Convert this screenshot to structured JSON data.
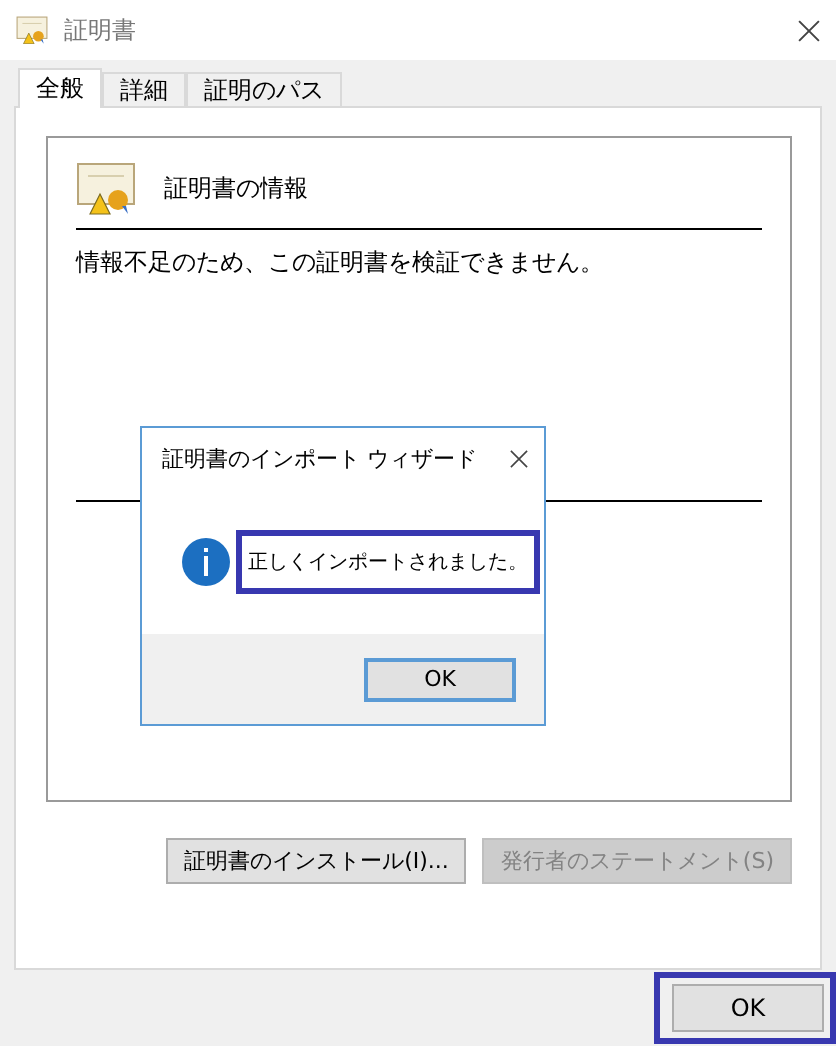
{
  "window": {
    "title": "証明書"
  },
  "tabs": [
    {
      "label": "全般",
      "selected": true
    },
    {
      "label": "詳細",
      "selected": false
    },
    {
      "label": "証明のパス",
      "selected": false
    }
  ],
  "certificate": {
    "heading": "証明書の情報",
    "message": "情報不足のため、この証明書を検証できません。"
  },
  "buttons": [
    {
      "label": "証明書のインストール(I)...",
      "disabled": false
    },
    {
      "label": "発行者のステートメント(S)",
      "disabled": true
    }
  ],
  "ok_button": {
    "label": "OK",
    "highlighted": true
  },
  "dialog": {
    "title": "証明書のインポート ウィザード",
    "message": "正しくインポートされました。",
    "message_highlighted": true,
    "ok_label": "OK"
  }
}
